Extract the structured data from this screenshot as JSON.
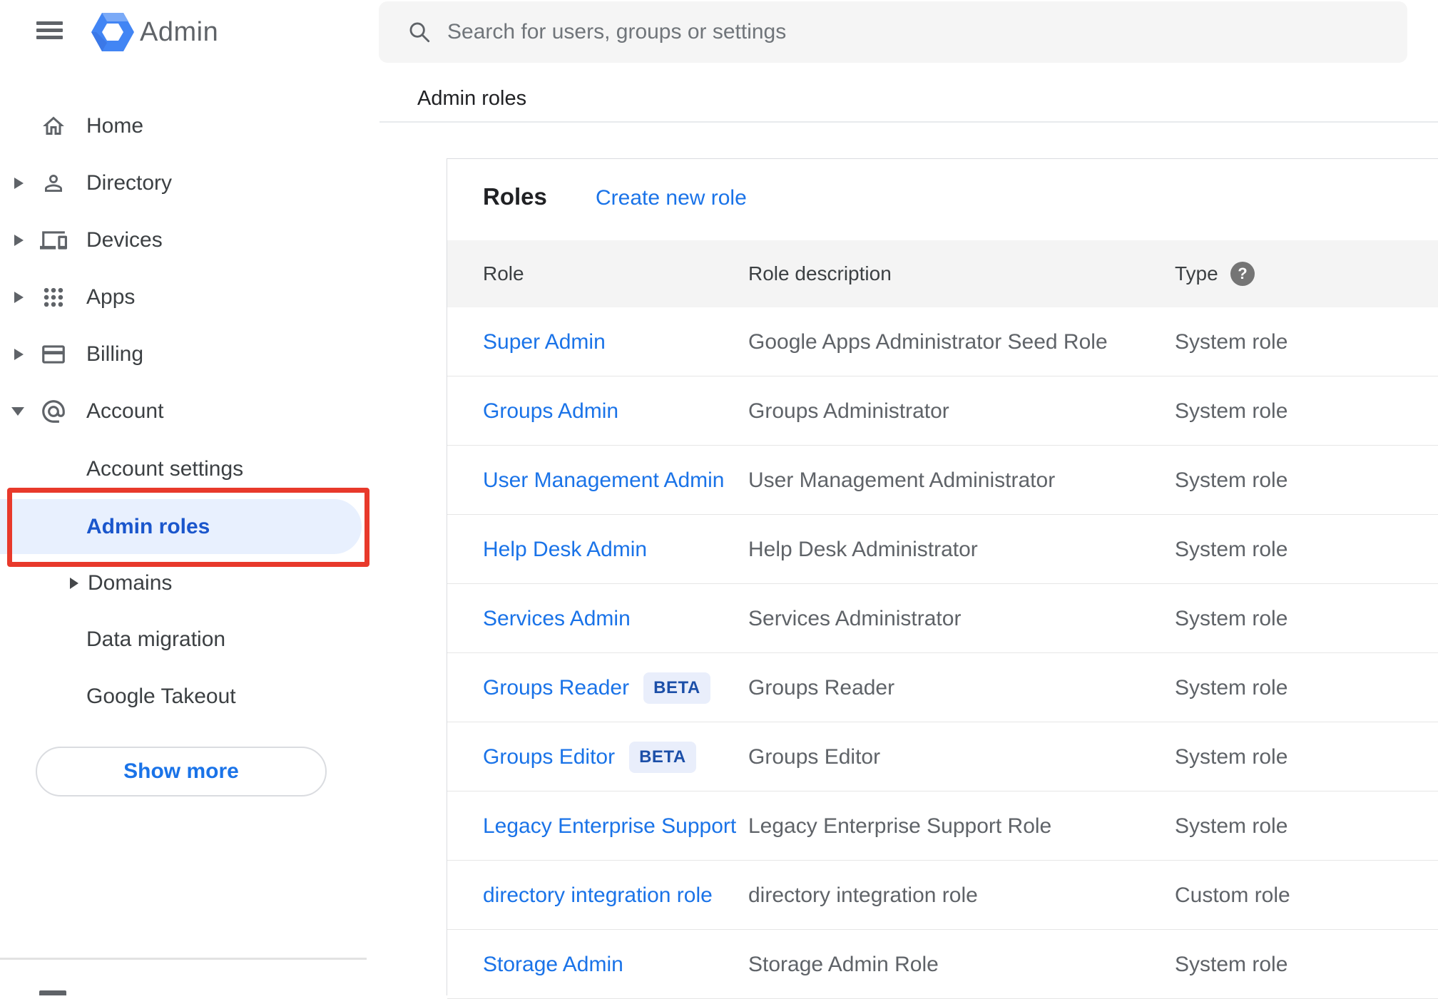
{
  "app": {
    "title": "Admin"
  },
  "topbar": {
    "search_placeholder": "Search for users, groups or settings"
  },
  "breadcrumb": {
    "label": "Admin roles"
  },
  "sidebar": {
    "items": [
      {
        "label": "Home"
      },
      {
        "label": "Directory"
      },
      {
        "label": "Devices"
      },
      {
        "label": "Apps"
      },
      {
        "label": "Billing"
      },
      {
        "label": "Account"
      }
    ],
    "account_children": [
      {
        "label": "Account settings"
      },
      {
        "label": "Admin roles"
      },
      {
        "label": "Domains"
      },
      {
        "label": "Data migration"
      },
      {
        "label": "Google Takeout"
      }
    ],
    "show_more_label": "Show more"
  },
  "main": {
    "roles_title": "Roles",
    "create_new_role_label": "Create new role",
    "table": {
      "columns": [
        "Role",
        "Role description",
        "Type"
      ],
      "beta_label": "BETA",
      "rows": [
        {
          "role": "Super Admin",
          "beta": false,
          "description": "Google Apps Administrator Seed Role",
          "type": "System role"
        },
        {
          "role": "Groups Admin",
          "beta": false,
          "description": "Groups Administrator",
          "type": "System role"
        },
        {
          "role": "User Management Admin",
          "beta": false,
          "description": "User Management Administrator",
          "type": "System role"
        },
        {
          "role": "Help Desk Admin",
          "beta": false,
          "description": "Help Desk Administrator",
          "type": "System role"
        },
        {
          "role": "Services Admin",
          "beta": false,
          "description": "Services Administrator",
          "type": "System role"
        },
        {
          "role": "Groups Reader",
          "beta": true,
          "description": "Groups Reader",
          "type": "System role"
        },
        {
          "role": "Groups Editor",
          "beta": true,
          "description": "Groups Editor",
          "type": "System role"
        },
        {
          "role": "Legacy Enterprise Support",
          "beta": false,
          "description": "Legacy Enterprise Support Role",
          "type": "System role"
        },
        {
          "role": "directory integration role",
          "beta": false,
          "description": "directory integration role",
          "type": "Custom role"
        },
        {
          "role": "Storage Admin",
          "beta": false,
          "description": "Storage Admin Role",
          "type": "System role"
        }
      ]
    }
  },
  "colors": {
    "link_blue": "#1a73e8",
    "selected_blue": "#1a56cc",
    "selected_bg": "#e8f0fe",
    "annotation_red": "#e8392b",
    "beta_bg": "#e9eefb",
    "beta_text": "#1c4fa8"
  }
}
